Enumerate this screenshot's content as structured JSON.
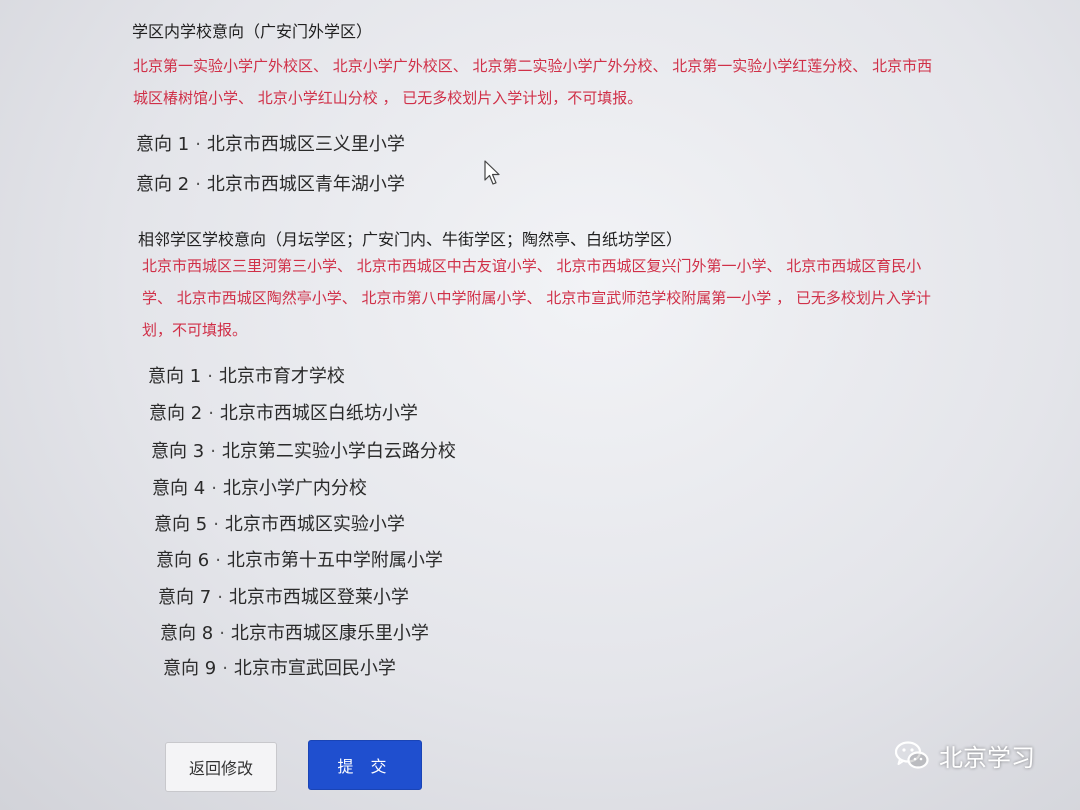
{
  "in_district": {
    "title": "学区内学校意向（广安门外学区）",
    "notice_line1": "北京第一实验小学广外校区、 北京小学广外校区、 北京第二实验小学广外分校、 北京第一实验小学红莲分校、 北京市西",
    "notice_line2": "城区椿树馆小学、 北京小学红山分校 ， 已无多校划片入学计划，不可填报。",
    "choices": [
      {
        "label": "意向 1",
        "school": "北京市西城区三义里小学"
      },
      {
        "label": "意向 2",
        "school": "北京市西城区青年湖小学"
      }
    ]
  },
  "adjacent": {
    "title": "相邻学区学校意向（月坛学区；广安门内、牛街学区；陶然亭、白纸坊学区）",
    "notice_line1": "北京市西城区三里河第三小学、 北京市西城区中古友谊小学、 北京市西城区复兴门外第一小学、 北京市西城区育民小",
    "notice_line2": "学、 北京市西城区陶然亭小学、 北京市第八中学附属小学、 北京市宣武师范学校附属第一小学 ， 已无多校划片入学计",
    "notice_line3": "划，不可填报。",
    "choices": [
      {
        "label": "意向 1",
        "school": "北京市育才学校"
      },
      {
        "label": "意向 2",
        "school": "北京市西城区白纸坊小学"
      },
      {
        "label": "意向 3",
        "school": "北京第二实验小学白云路分校"
      },
      {
        "label": "意向 4",
        "school": "北京小学广内分校"
      },
      {
        "label": "意向 5",
        "school": "北京市西城区实验小学"
      },
      {
        "label": "意向 6",
        "school": "北京市第十五中学附属小学"
      },
      {
        "label": "意向 7",
        "school": "北京市西城区登莱小学"
      },
      {
        "label": "意向 8",
        "school": "北京市西城区康乐里小学"
      },
      {
        "label": "意向 9",
        "school": "北京市宣武回民小学"
      }
    ]
  },
  "separator": "·",
  "buttons": {
    "back": "返回修改",
    "submit": "提 交"
  },
  "watermark": {
    "text": "北京学习",
    "icon": "wechat-icon"
  },
  "colors": {
    "notice": "#d03048",
    "submit_bg": "#1f4fcf"
  }
}
